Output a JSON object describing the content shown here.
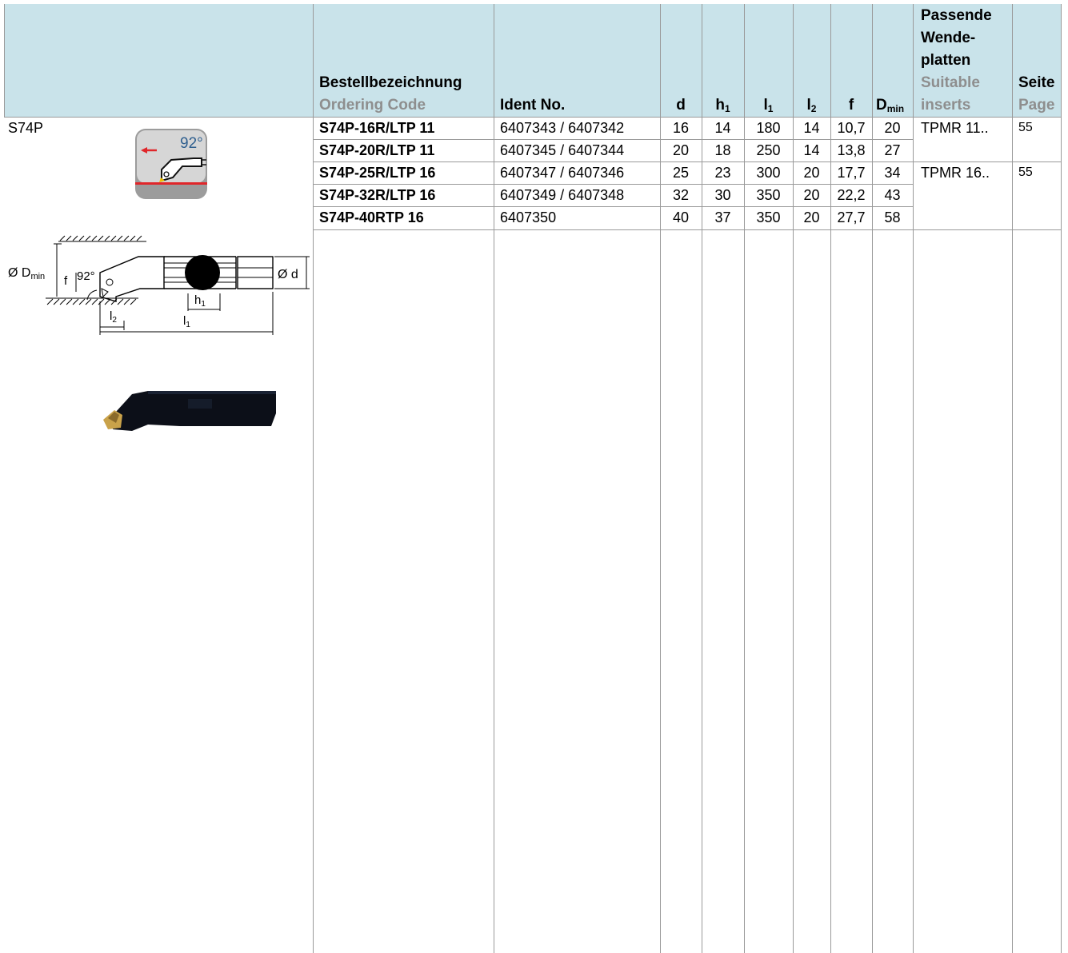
{
  "product": {
    "name": "S74P",
    "angle": "92°"
  },
  "headers": {
    "ordering_de": "Bestellbezeichnung",
    "ordering_en": "Ordering Code",
    "ident": "Ident No.",
    "d": "d",
    "h1": "h",
    "h1_sub": "1",
    "l1": "l",
    "l1_sub": "1",
    "l2": "l",
    "l2_sub": "2",
    "f": "f",
    "dmin": "D",
    "dmin_sub": "min",
    "inserts_de_1": "Passende",
    "inserts_de_2": "Wende-",
    "inserts_de_3": "platten",
    "inserts_en_1": "Suitable",
    "inserts_en_2": "inserts",
    "page_de": "Seite",
    "page_en": "Page"
  },
  "rows": [
    {
      "code": "S74P-16R/LTP 11",
      "ident": "6407343 / 6407342",
      "d": "16",
      "h1": "14",
      "l1": "180",
      "l2": "14",
      "f": "10,7",
      "dmin": "20"
    },
    {
      "code": "S74P-20R/LTP 11",
      "ident": "6407345 / 6407344",
      "d": "20",
      "h1": "18",
      "l1": "250",
      "l2": "14",
      "f": "13,8",
      "dmin": "27"
    },
    {
      "code": "S74P-25R/LTP 16",
      "ident": "6407347 / 6407346",
      "d": "25",
      "h1": "23",
      "l1": "300",
      "l2": "20",
      "f": "17,7",
      "dmin": "34"
    },
    {
      "code": "S74P-32R/LTP 16",
      "ident": "6407349 / 6407348",
      "d": "32",
      "h1": "30",
      "l1": "350",
      "l2": "20",
      "f": "22,2",
      "dmin": "43"
    },
    {
      "code": "S74P-40RTP 16",
      "ident": "6407350",
      "d": "40",
      "h1": "37",
      "l1": "350",
      "l2": "20",
      "f": "27,7",
      "dmin": "58"
    }
  ],
  "inserts": [
    {
      "insert": "TPMR 11..",
      "page": "55"
    },
    {
      "insert": "TPMR 16..",
      "page": "55"
    }
  ],
  "drawing": {
    "dmin_label": "Ø D",
    "dmin_sub": "min",
    "f_label": "f",
    "angle_label": "92°",
    "h1_label": "h",
    "h1_sub": "1",
    "l2_label": "l",
    "l2_sub": "2",
    "l1_label": "l",
    "l1_sub": "1",
    "d_label": "Ø d"
  },
  "colors": {
    "header_bg": "#c9e3ea",
    "grid": "#9a9a9a",
    "grey_text": "#8e8e8e",
    "arrow": "#e0262a",
    "icon_bg": "#9c9c9c"
  }
}
